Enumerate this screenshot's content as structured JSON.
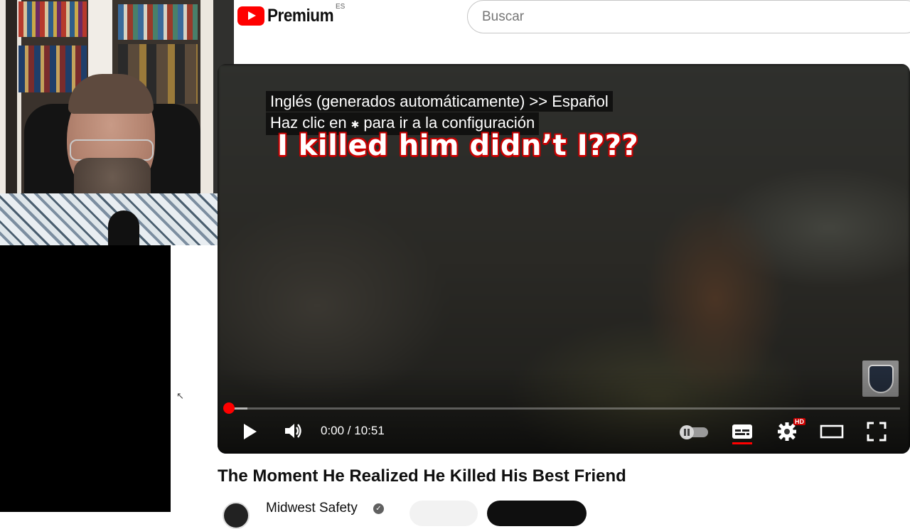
{
  "header": {
    "logo_text": "Premium",
    "country_code": "ES",
    "search_placeholder": "Buscar"
  },
  "player": {
    "caption_line1": "Inglés (generados automáticamente) >> Español",
    "caption_line2_before": "Haz clic en",
    "caption_line2_icon": "gear-icon",
    "caption_line2_after": "para ir a la configuración",
    "burned_subtitle": "I killed him didn’t I???",
    "time_display": "0:00 / 10:51",
    "progress_fraction": 0.0,
    "buffered_fraction": 0.03,
    "quality_badge": "HD",
    "autoplay_on": false,
    "captions_on": true
  },
  "video": {
    "title": "The Moment He Realized He Killed His Best Friend",
    "channel_name": "Midwest Safety"
  },
  "colors": {
    "brand_red": "#ff0000",
    "text_primary": "#0f0f0f",
    "text_secondary": "#606060"
  }
}
